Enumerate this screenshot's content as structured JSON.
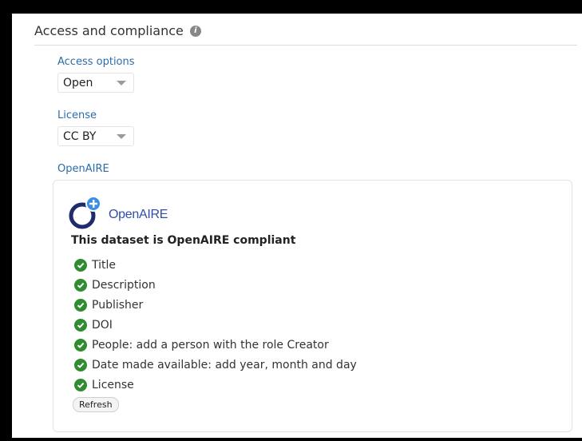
{
  "section": {
    "title": "Access and compliance",
    "info_icon": "info-icon"
  },
  "access_options": {
    "label": "Access options",
    "value": "Open"
  },
  "license": {
    "label": "License",
    "value": "CC BY"
  },
  "openaire": {
    "label": "OpenAIRE",
    "logo_text": "OpenAIRE",
    "status": "This dataset is OpenAIRE compliant",
    "checks": [
      {
        "label": "Title"
      },
      {
        "label": "Description"
      },
      {
        "label": "Publisher"
      },
      {
        "label": "DOI"
      },
      {
        "label": "People: add a person with the role Creator"
      },
      {
        "label": "Date made available: add year, month and day"
      },
      {
        "label": "License"
      }
    ],
    "refresh_label": "Refresh"
  },
  "colors": {
    "label_blue": "#2a6ca8",
    "check_green": "#2f8c2f",
    "logo_blue": "#2f4fa8",
    "logo_navy": "#1f2b6b",
    "logo_plus": "#3a8ee6"
  }
}
